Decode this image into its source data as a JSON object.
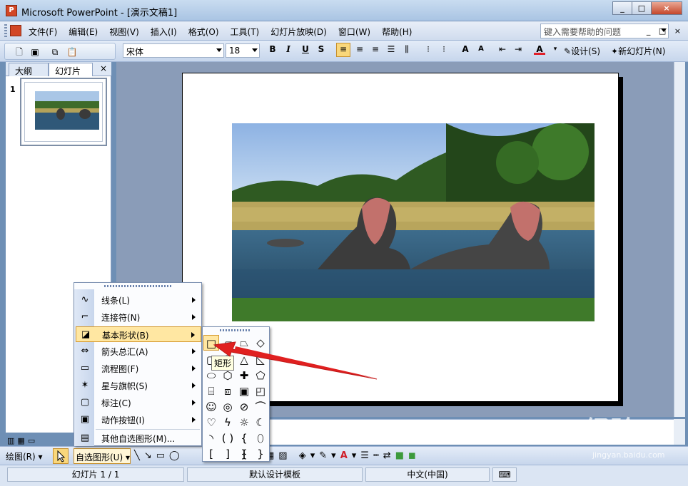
{
  "window": {
    "title": "Microsoft PowerPoint - [演示文稿1]",
    "app_icon": "powerpoint-icon",
    "buttons": [
      "_",
      "□",
      "×"
    ]
  },
  "menu": {
    "items": [
      "文件(F)",
      "编辑(E)",
      "视图(V)",
      "插入(I)",
      "格式(O)",
      "工具(T)",
      "幻灯片放映(D)",
      "窗口(W)",
      "帮助(H)"
    ],
    "help_placeholder": "键入需要帮助的问题",
    "mdi": "_ □ ×"
  },
  "toolbar": {
    "font": "宋体",
    "size": "18",
    "bold": "B",
    "italic": "I",
    "underline": "U",
    "shadow": "S",
    "design": "设计(S)",
    "new_slide": "新幻灯片(N)"
  },
  "left_pane": {
    "tab_outline": "大纲",
    "tab_slides": "幻灯片",
    "close": "×",
    "slide_number": "1"
  },
  "autoshape_menu": {
    "items": [
      {
        "label": "线条(L)",
        "icon": "lines-icon",
        "glyph": "∿"
      },
      {
        "label": "连接符(N)",
        "icon": "connector-icon",
        "glyph": "⌐"
      },
      {
        "label": "基本形状(B)",
        "icon": "basic-shapes-icon",
        "glyph": "◪"
      },
      {
        "label": "箭头总汇(A)",
        "icon": "block-arrows-icon",
        "glyph": "⇔"
      },
      {
        "label": "流程图(F)",
        "icon": "flowchart-icon",
        "glyph": "▭"
      },
      {
        "label": "星与旗帜(S)",
        "icon": "stars-banners-icon",
        "glyph": "✶"
      },
      {
        "label": "标注(C)",
        "icon": "callouts-icon",
        "glyph": "▢"
      },
      {
        "label": "动作按钮(I)",
        "icon": "action-buttons-icon",
        "glyph": "▣"
      }
    ],
    "more": "其他自选图形(M)..."
  },
  "tooltip": "矩形",
  "drawbar": {
    "draw": "绘图(R)",
    "autoshapes": "自选图形(U)"
  },
  "status": {
    "slide": "幻灯片 1 / 1",
    "template": "默认设计模板",
    "language": "中文(中国)"
  },
  "watermark": {
    "text": "Bai 经验",
    "url": "jingyan.baidu.com"
  }
}
